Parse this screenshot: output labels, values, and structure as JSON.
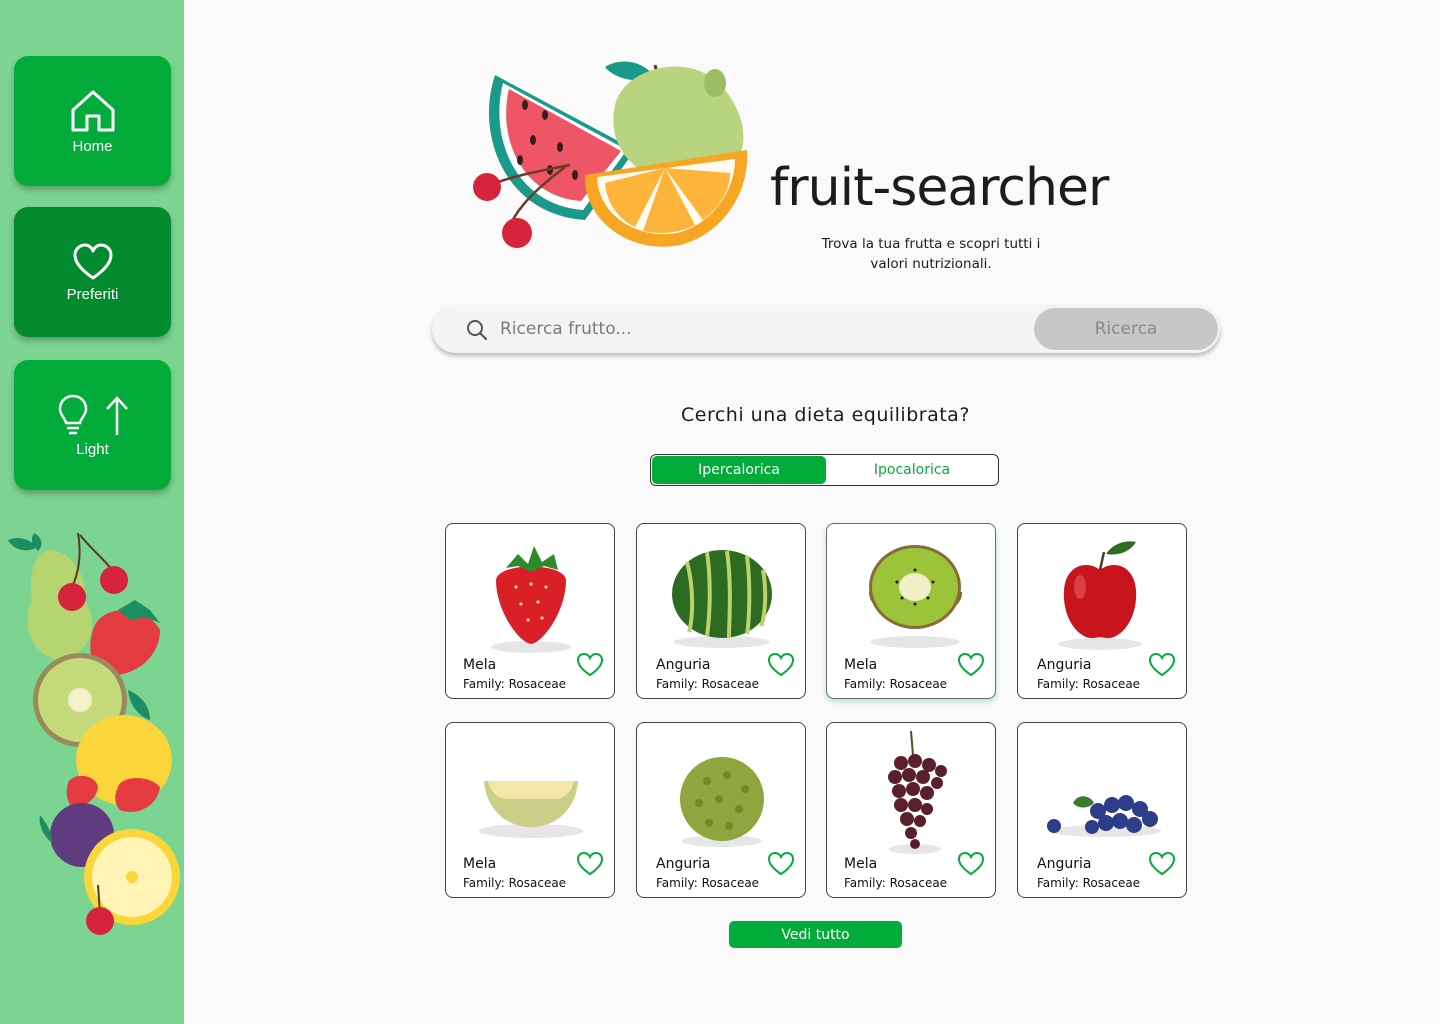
{
  "sidebar": {
    "home_label": "Home",
    "favorites_label": "Preferiti",
    "light_label": "Light"
  },
  "header": {
    "title": "fruit-searcher",
    "tagline": "Trova la tua frutta e scopri tutti i valori nutrizionali."
  },
  "search": {
    "placeholder": "Ricerca frutto...",
    "value": "",
    "button_label": "Ricerca"
  },
  "diet": {
    "question": "Cerchi una dieta equilibrata?",
    "options": [
      "Ipercalorica",
      "Ipocalorica"
    ],
    "selected": "Ipercalorica"
  },
  "cards": [
    {
      "name": "Mela",
      "family": "Family: Rosaceae",
      "image": "strawberry"
    },
    {
      "name": "Anguria",
      "family": "Family: Rosaceae",
      "image": "watermelon"
    },
    {
      "name": "Mela",
      "family": "Family: Rosaceae",
      "image": "kiwi"
    },
    {
      "name": "Anguria",
      "family": "Family: Rosaceae",
      "image": "apple"
    },
    {
      "name": "Mela",
      "family": "Family: Rosaceae",
      "image": "melon"
    },
    {
      "name": "Anguria",
      "family": "Family: Rosaceae",
      "image": "durian"
    },
    {
      "name": "Mela",
      "family": "Family: Rosaceae",
      "image": "grapes"
    },
    {
      "name": "Anguria",
      "family": "Family: Rosaceae",
      "image": "blueberries"
    }
  ],
  "see_all_label": "Vedi tutto",
  "colors": {
    "accent": "#03ac3a",
    "accent_dark": "#028a2f",
    "sidebar_bg": "#7cd491",
    "heart": "#03ac3a"
  }
}
